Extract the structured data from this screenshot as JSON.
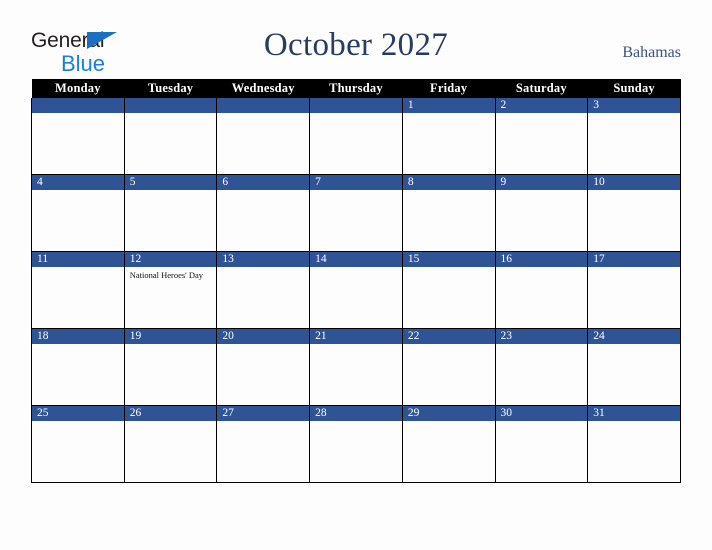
{
  "brand": {
    "word_1": "General",
    "word_2": "Blue",
    "triangle_icon": "blue-triangle-icon",
    "color_dark": "#231f20",
    "color_blue": "#1B7FD4"
  },
  "header": {
    "title": "October 2027",
    "country": "Bahamas",
    "title_color": "#273B63",
    "country_color": "#3C527D"
  },
  "calendar": {
    "accent_color": "#2F5496",
    "header_bg": "#000000",
    "weekday_headers": [
      "Monday",
      "Tuesday",
      "Wednesday",
      "Thursday",
      "Friday",
      "Saturday",
      "Sunday"
    ],
    "weeks": [
      [
        {
          "day": "",
          "event": ""
        },
        {
          "day": "",
          "event": ""
        },
        {
          "day": "",
          "event": ""
        },
        {
          "day": "",
          "event": ""
        },
        {
          "day": "1",
          "event": ""
        },
        {
          "day": "2",
          "event": ""
        },
        {
          "day": "3",
          "event": ""
        }
      ],
      [
        {
          "day": "4",
          "event": ""
        },
        {
          "day": "5",
          "event": ""
        },
        {
          "day": "6",
          "event": ""
        },
        {
          "day": "7",
          "event": ""
        },
        {
          "day": "8",
          "event": ""
        },
        {
          "day": "9",
          "event": ""
        },
        {
          "day": "10",
          "event": ""
        }
      ],
      [
        {
          "day": "11",
          "event": ""
        },
        {
          "day": "12",
          "event": "National Heroes' Day"
        },
        {
          "day": "13",
          "event": ""
        },
        {
          "day": "14",
          "event": ""
        },
        {
          "day": "15",
          "event": ""
        },
        {
          "day": "16",
          "event": ""
        },
        {
          "day": "17",
          "event": ""
        }
      ],
      [
        {
          "day": "18",
          "event": ""
        },
        {
          "day": "19",
          "event": ""
        },
        {
          "day": "20",
          "event": ""
        },
        {
          "day": "21",
          "event": ""
        },
        {
          "day": "22",
          "event": ""
        },
        {
          "day": "23",
          "event": ""
        },
        {
          "day": "24",
          "event": ""
        }
      ],
      [
        {
          "day": "25",
          "event": ""
        },
        {
          "day": "26",
          "event": ""
        },
        {
          "day": "27",
          "event": ""
        },
        {
          "day": "28",
          "event": ""
        },
        {
          "day": "29",
          "event": ""
        },
        {
          "day": "30",
          "event": ""
        },
        {
          "day": "31",
          "event": ""
        }
      ]
    ]
  }
}
